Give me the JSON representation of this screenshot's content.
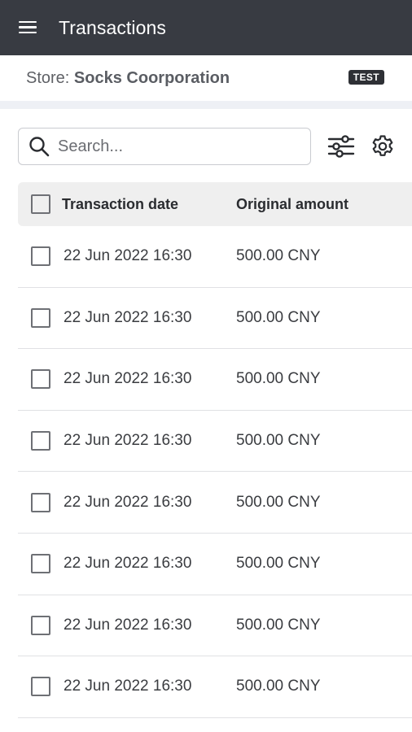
{
  "appbar": {
    "title": "Transactions",
    "menu_icon": "hamburger-menu-icon"
  },
  "store": {
    "prefix": "Store: ",
    "name": "Socks Coorporation",
    "badge": "TEST"
  },
  "search": {
    "placeholder": "Search...",
    "value": "",
    "icon": "search-icon"
  },
  "toolbar": {
    "filter_icon": "sliders-filter-icon",
    "settings_icon": "gear-icon"
  },
  "table": {
    "columns": [
      "Transaction date",
      "Original amount"
    ],
    "rows": [
      {
        "date": "22 Jun 2022 16:30",
        "amount": "500.00 CNY"
      },
      {
        "date": "22 Jun 2022 16:30",
        "amount": "500.00 CNY"
      },
      {
        "date": "22 Jun 2022 16:30",
        "amount": "500.00 CNY"
      },
      {
        "date": "22 Jun 2022 16:30",
        "amount": "500.00 CNY"
      },
      {
        "date": "22 Jun 2022 16:30",
        "amount": "500.00 CNY"
      },
      {
        "date": "22 Jun 2022 16:30",
        "amount": "500.00 CNY"
      },
      {
        "date": "22 Jun 2022 16:30",
        "amount": "500.00 CNY"
      },
      {
        "date": "22 Jun 2022 16:30",
        "amount": "500.00 CNY"
      }
    ]
  },
  "colors": {
    "appbar_bg": "#383b42",
    "header_row_bg": "#efefef",
    "badge_bg": "#2e3035"
  }
}
